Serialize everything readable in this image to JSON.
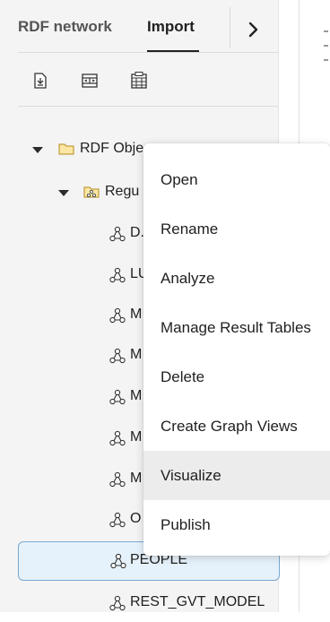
{
  "tabs": [
    {
      "label": "RDF network",
      "active": false
    },
    {
      "label": "Import",
      "active": true
    }
  ],
  "toolbar": {
    "icons": [
      "import-file-icon",
      "split-layout-icon",
      "table-grid-icon"
    ]
  },
  "tree": {
    "root": {
      "label": "RDF Obje",
      "icon": "folder-icon"
    },
    "child": {
      "label": "Regu",
      "icon": "model-folder-icon"
    },
    "items": [
      {
        "label": "D."
      },
      {
        "label": "LU"
      },
      {
        "label": "M"
      },
      {
        "label": "M"
      },
      {
        "label": "M"
      },
      {
        "label": "M"
      },
      {
        "label": "M"
      },
      {
        "label": "O"
      },
      {
        "label": "PEOPLE",
        "selected": true
      },
      {
        "label": "REST_GVT_MODEL"
      }
    ]
  },
  "context_menu": {
    "items": [
      {
        "label": "Open"
      },
      {
        "label": "Rename"
      },
      {
        "label": "Analyze"
      },
      {
        "label": "Manage Result Tables"
      },
      {
        "label": "Delete"
      },
      {
        "label": "Create Graph Views"
      },
      {
        "label": "Visualize",
        "hovered": true
      },
      {
        "label": "Publish"
      }
    ]
  },
  "colors": {
    "panel_bg": "#f4f4f4",
    "selection_bg": "#e6f2fb",
    "selection_border": "#79a8cf",
    "menu_hover": "#ececec",
    "folder": "#e8b84a"
  }
}
